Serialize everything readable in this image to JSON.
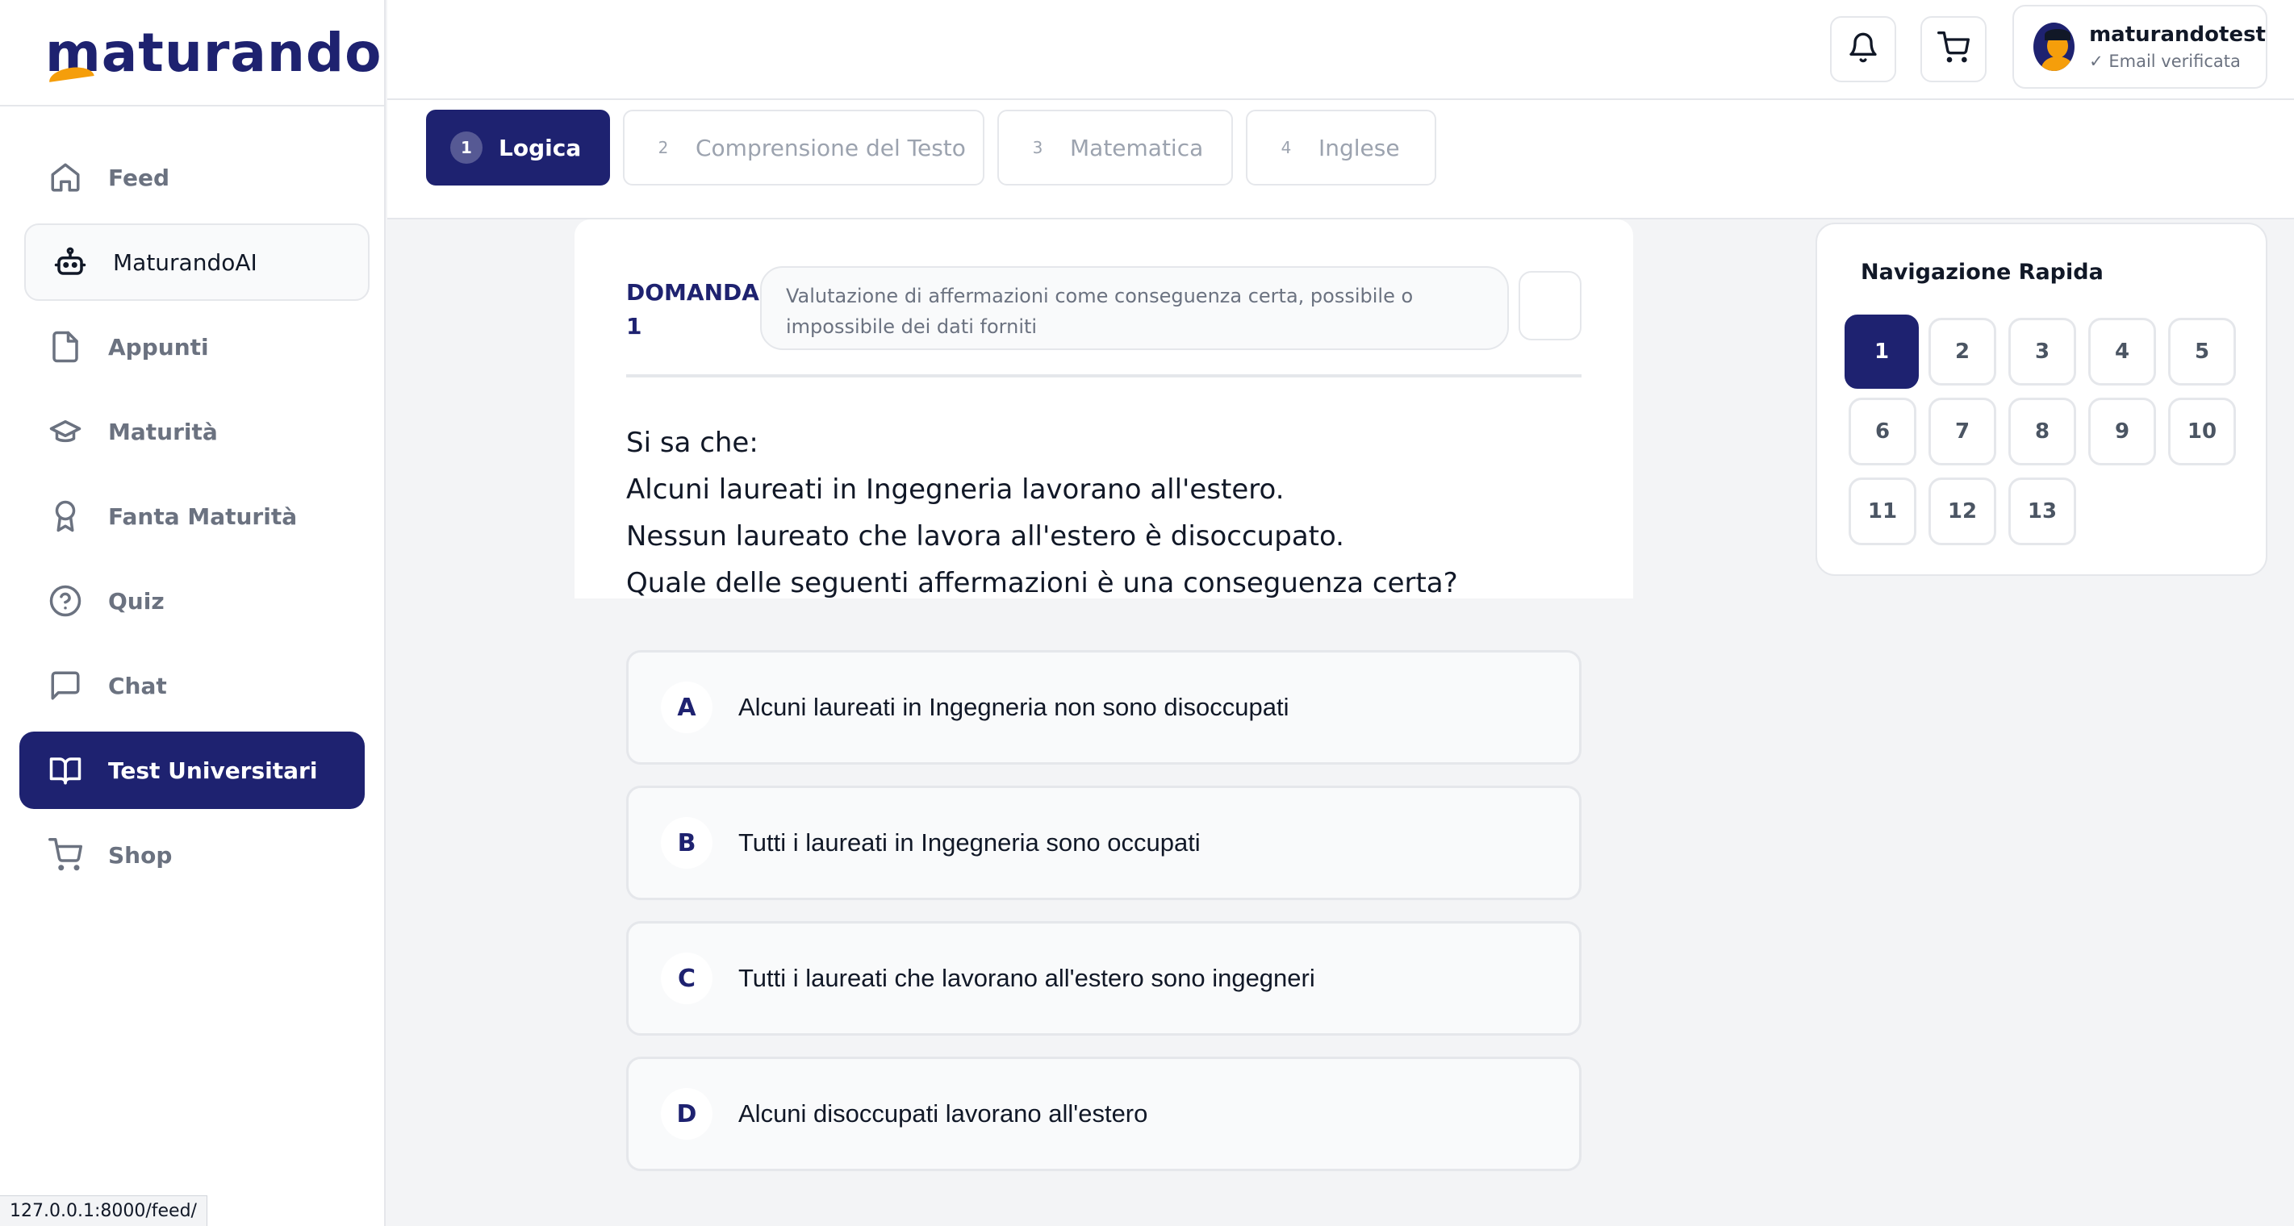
{
  "brand": {
    "logo": "maturando",
    "accent": "#1e2270",
    "swoosh": "#f59e0b"
  },
  "sidebar": {
    "items": [
      {
        "label": "Feed",
        "icon": "home-icon"
      },
      {
        "label": "MaturandoAI",
        "icon": "robot-icon"
      },
      {
        "label": "Appunti",
        "icon": "document-icon"
      },
      {
        "label": "Maturità",
        "icon": "graduation-cap-icon"
      },
      {
        "label": "Fanta Maturità",
        "icon": "award-icon"
      },
      {
        "label": "Quiz",
        "icon": "help-circle-icon"
      },
      {
        "label": "Chat",
        "icon": "message-icon"
      },
      {
        "label": "Test Universitari",
        "icon": "book-open-icon",
        "active": true
      },
      {
        "label": "Shop",
        "icon": "cart-icon"
      }
    ]
  },
  "header": {
    "user_name": "maturandotest",
    "user_status": "✓ Email verificata"
  },
  "tabs": [
    {
      "num": "1",
      "label": "Logica",
      "active": true
    },
    {
      "num": "2",
      "label": "Comprensione del Testo"
    },
    {
      "num": "3",
      "label": "Matematica"
    },
    {
      "num": "4",
      "label": "Inglese"
    }
  ],
  "question": {
    "label_word": "DOMANDA",
    "label_num": "1",
    "description": "Valutazione di affermazioni come conseguenza certa, possibile o impossibile dei dati forniti",
    "lines": [
      "Si sa che:",
      "Alcuni laureati in Ingegneria lavorano all'estero.",
      "Nessun laureato che lavora all'estero è disoccupato.",
      "Quale delle seguenti affermazioni è una conseguenza certa?"
    ],
    "answers": [
      {
        "letter": "A",
        "text": "Alcuni laureati in Ingegneria non sono disoccupati"
      },
      {
        "letter": "B",
        "text": "Tutti i laureati in Ingegneria sono occupati"
      },
      {
        "letter": "C",
        "text": "Tutti i laureati che lavorano all'estero sono ingegneri"
      },
      {
        "letter": "D",
        "text": "Alcuni disoccupati lavorano all'estero"
      }
    ]
  },
  "quick_nav": {
    "title": "Navigazione Rapida",
    "numbers": [
      "1",
      "2",
      "3",
      "4",
      "5",
      "6",
      "7",
      "8",
      "9",
      "10",
      "11",
      "12",
      "13"
    ],
    "current": "1"
  },
  "status_url": "127.0.0.1:8000/feed/"
}
